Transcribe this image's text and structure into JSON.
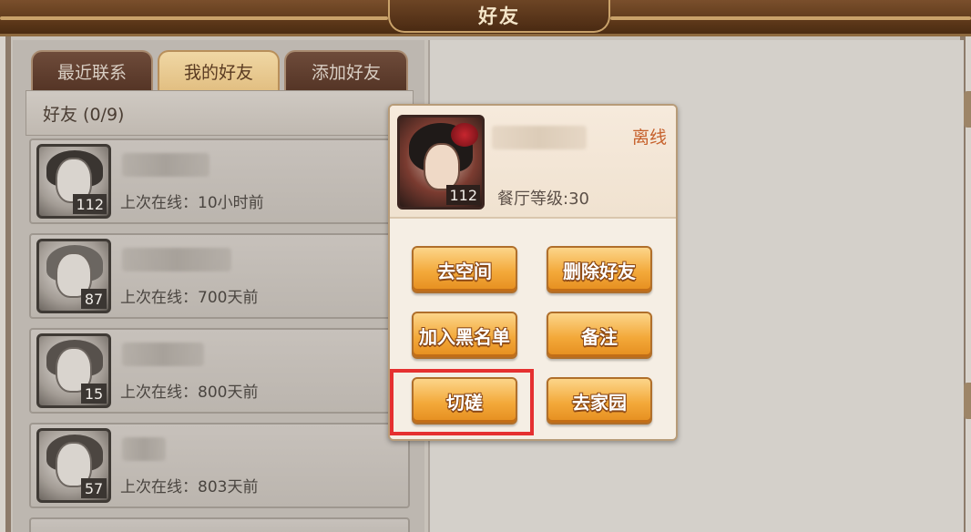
{
  "window": {
    "title": "好友"
  },
  "tabs": [
    {
      "label": "最近联系",
      "active": false
    },
    {
      "label": "我的好友",
      "active": true
    },
    {
      "label": "添加好友",
      "active": false
    }
  ],
  "friend_list": {
    "header": "好友 (0/9)",
    "items": [
      {
        "level": "112",
        "last_online": "上次在线：10小时前"
      },
      {
        "level": "87",
        "last_online": "上次在线：700天前"
      },
      {
        "level": "15",
        "last_online": "上次在线：800天前"
      },
      {
        "level": "57",
        "last_online": "上次在线：803天前"
      }
    ]
  },
  "popup": {
    "level": "112",
    "status": "离线",
    "restaurant_level": "餐厅等级:30",
    "buttons": {
      "visit_space": "去空间",
      "delete_friend": "删除好友",
      "add_blacklist": "加入黑名单",
      "note": "备注",
      "spar": "切磋",
      "visit_home": "去家园"
    }
  },
  "colors": {
    "status_offline": "#c6612c",
    "highlight": "#e53030",
    "button_orange": "#f3a93a"
  }
}
